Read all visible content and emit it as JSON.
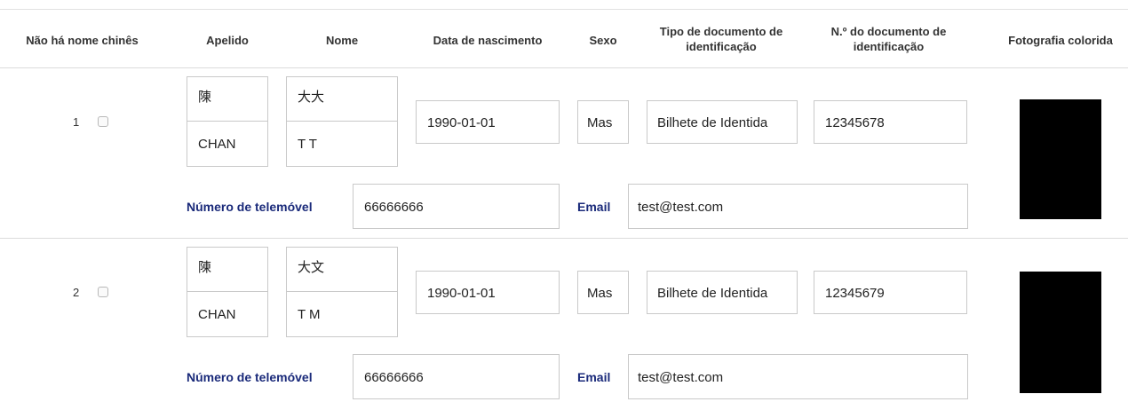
{
  "headers": {
    "no_chinese_name": "Não há nome chinês",
    "surname": "Apelido",
    "name": "Nome",
    "birth_date": "Data de nascimento",
    "sex": "Sexo",
    "doc_type_line1": "Tipo de documento de",
    "doc_type_line2": "identificação",
    "doc_number_line1": "N.º do documento de",
    "doc_number_line2": "identificação",
    "photo": "Fotografia colorida"
  },
  "rows": [
    {
      "index": "1",
      "surname_chinese": "陳",
      "name_chinese": "大大",
      "surname_latin": "CHAN",
      "name_latin": "T T",
      "birth_date": "1990-01-01",
      "sex": "Mas",
      "doc_type": "Bilhete de Identida",
      "doc_number": "12345678",
      "mobile_label": "Número de telemóvel",
      "mobile": "66666666",
      "email_label": "Email",
      "email": "test@test.com"
    },
    {
      "index": "2",
      "surname_chinese": "陳",
      "name_chinese": "大文",
      "surname_latin": "CHAN",
      "name_latin": "T M",
      "birth_date": "1990-01-01",
      "sex": "Mas",
      "doc_type": "Bilhete de Identida",
      "doc_number": "12345679",
      "mobile_label": "Número de telemóvel",
      "mobile": "66666666",
      "email_label": "Email",
      "email": "test@test.com"
    }
  ]
}
